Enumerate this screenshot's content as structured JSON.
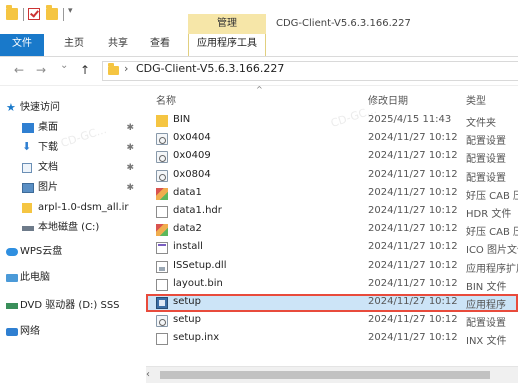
{
  "titlebar": {
    "context_tab": "管理",
    "window_title": "CDG-Client-V5.6.3.166.227"
  },
  "ribbon": {
    "tabs": [
      "文件",
      "主页",
      "共享",
      "查看"
    ],
    "context_label": "应用程序工具"
  },
  "address": {
    "path": "CDG-Client-V5.6.3.166.227"
  },
  "nav_pane": {
    "items": [
      {
        "label": "快速访问",
        "icon": "star-icon"
      },
      {
        "label": "桌面",
        "icon": "desktop-icon",
        "pinned": true
      },
      {
        "label": "下载",
        "icon": "download-icon",
        "pinned": true
      },
      {
        "label": "文档",
        "icon": "document-icon",
        "pinned": true
      },
      {
        "label": "图片",
        "icon": "picture-icon",
        "pinned": true
      },
      {
        "label": "arpl-1.0-dsm_all.ir",
        "icon": "folder-icon"
      },
      {
        "label": "本地磁盘 (C:)",
        "icon": "drive-icon"
      },
      {
        "label": "WPS云盘",
        "icon": "cloud-icon"
      },
      {
        "label": "此电脑",
        "icon": "computer-icon"
      },
      {
        "label": "DVD 驱动器 (D:) SSS",
        "icon": "dvd-icon"
      },
      {
        "label": "网络",
        "icon": "network-icon"
      }
    ],
    "pin_glyph": "✱"
  },
  "file_list": {
    "columns": {
      "name": "名称",
      "date": "修改日期",
      "type": "类型"
    },
    "rows": [
      {
        "name": "BIN",
        "date": "2025/4/15 11:43",
        "type": "文件夹",
        "icon": "folder-icon"
      },
      {
        "name": "0x0404",
        "date": "2024/11/27 10:12",
        "type": "配置设置",
        "icon": "config-icon"
      },
      {
        "name": "0x0409",
        "date": "2024/11/27 10:12",
        "type": "配置设置",
        "icon": "config-icon"
      },
      {
        "name": "0x0804",
        "date": "2024/11/27 10:12",
        "type": "配置设置",
        "icon": "config-icon"
      },
      {
        "name": "data1",
        "date": "2024/11/27 10:12",
        "type": "好压 CAB 压",
        "icon": "cab-icon"
      },
      {
        "name": "data1.hdr",
        "date": "2024/11/27 10:12",
        "type": "HDR 文件",
        "icon": "file-icon"
      },
      {
        "name": "data2",
        "date": "2024/11/27 10:12",
        "type": "好压 CAB 压",
        "icon": "cab-icon"
      },
      {
        "name": "install",
        "date": "2024/11/27 10:12",
        "type": "ICO 图片文件",
        "icon": "install-icon"
      },
      {
        "name": "ISSetup.dll",
        "date": "2024/11/27 10:12",
        "type": "应用程序扩展",
        "icon": "dll-icon"
      },
      {
        "name": "layout.bin",
        "date": "2024/11/27 10:12",
        "type": "BIN 文件",
        "icon": "file-icon"
      },
      {
        "name": "setup",
        "date": "2024/11/27 10:12",
        "type": "应用程序",
        "icon": "setup-icon",
        "selected": true
      },
      {
        "name": "setup",
        "date": "2024/11/27 10:12",
        "type": "配置设置",
        "icon": "config-icon"
      },
      {
        "name": "setup.inx",
        "date": "2024/11/27 10:12",
        "type": "INX 文件",
        "icon": "file-icon"
      }
    ]
  },
  "nav_buttons": {
    "back": "←",
    "forward": "→",
    "recent": "⌄",
    "up": "↑",
    "chevron": "›",
    "sort": "^",
    "scroll_left": "‹"
  },
  "colors": {
    "accent": "#1979ca",
    "selection": "#cce4f7",
    "highlight_outline": "#e84b3c",
    "context_tab": "#f6e6a8"
  }
}
